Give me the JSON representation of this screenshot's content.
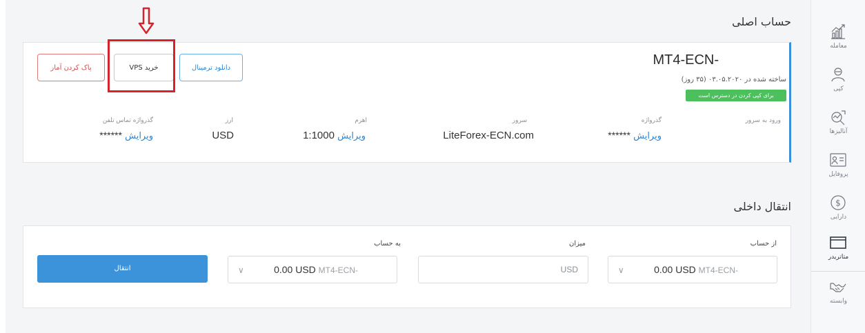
{
  "main_account": {
    "heading": "حساب اصلی",
    "name": "MT4-ECN-",
    "created": "ساخته شده در ۰۳.۰۵.۲۰۲۰ (۳۵ روز)",
    "copy_badge": "برای کپی کردن در دسترس است",
    "buttons": {
      "clear_stats": "پاک کردن آمار",
      "buy_vps": "خرید VPS",
      "download_terminal": "دانلود ترمینال"
    },
    "fields": {
      "login_label": "ورود به سرور",
      "login_value": "",
      "password_label": "گذرواژه",
      "password_value": "******",
      "password_edit": "ویرایش",
      "server_label": "سرور",
      "server_value": "LiteForex-ECN.com",
      "leverage_label": "اهرم",
      "leverage_value": "1:1000",
      "leverage_edit": "ویرایش",
      "currency_label": "ارز",
      "currency_value": "USD",
      "phone_pw_label": "گذرواژه تماس تلفن",
      "phone_pw_value": "******",
      "phone_pw_edit": "ویرایش"
    }
  },
  "transfer": {
    "heading": "انتقال داخلی",
    "from_label": "از حساب",
    "from_balance": "0.00 USD",
    "from_account": "MT4-ECN-",
    "amount_label": "میزان",
    "amount_unit": "USD",
    "to_label": "به حساب",
    "to_balance": "0.00 USD",
    "to_account": "MT4-ECN-",
    "submit": "انتقال"
  },
  "sidebar": {
    "items": [
      {
        "label": "معامله",
        "icon": "trading-chart-icon"
      },
      {
        "label": "کپی",
        "icon": "copy-trader-icon"
      },
      {
        "label": "آنالیزها",
        "icon": "analytics-icon"
      },
      {
        "label": "پروفایل",
        "icon": "profile-card-icon"
      },
      {
        "label": "دارایی",
        "icon": "dollar-coin-icon"
      },
      {
        "label": "متاتریدر",
        "icon": "metatrader-window-icon"
      },
      {
        "label": "وابسته",
        "icon": "handshake-icon"
      }
    ]
  },
  "colors": {
    "accent": "#3d93da",
    "danger": "#d34c4c",
    "success": "#4cc05c",
    "highlight": "#d4232a"
  }
}
